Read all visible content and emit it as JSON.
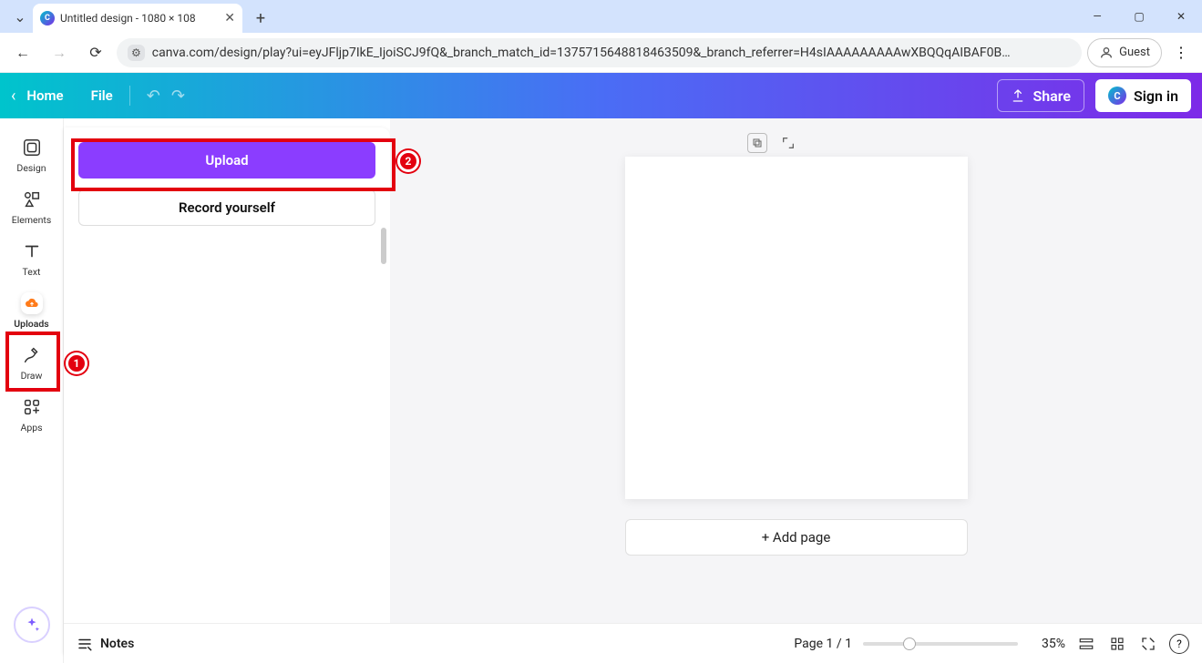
{
  "tab": {
    "title": "Untitled design - 1080 × 108"
  },
  "addr": {
    "url": "canva.com/design/play?ui=eyJFljp7IkE_IjoiSCJ9fQ&_branch_match_id=1375715648818463509&_branch_referrer=H4sIAAAAAAAAAwXBQQqAIBAF0B…",
    "guest": "Guest"
  },
  "top": {
    "home": "Home",
    "file": "File",
    "share": "Share",
    "signin": "Sign in"
  },
  "nav": {
    "design": "Design",
    "elements": "Elements",
    "text": "Text",
    "uploads": "Uploads",
    "draw": "Draw",
    "apps": "Apps"
  },
  "panel": {
    "upload": "Upload",
    "record": "Record yourself"
  },
  "canvas": {
    "addPage": "+ Add page"
  },
  "footer": {
    "notes": "Notes",
    "pages": "Page 1 / 1",
    "zoom": "35%"
  },
  "callouts": {
    "one": "1",
    "two": "2"
  }
}
